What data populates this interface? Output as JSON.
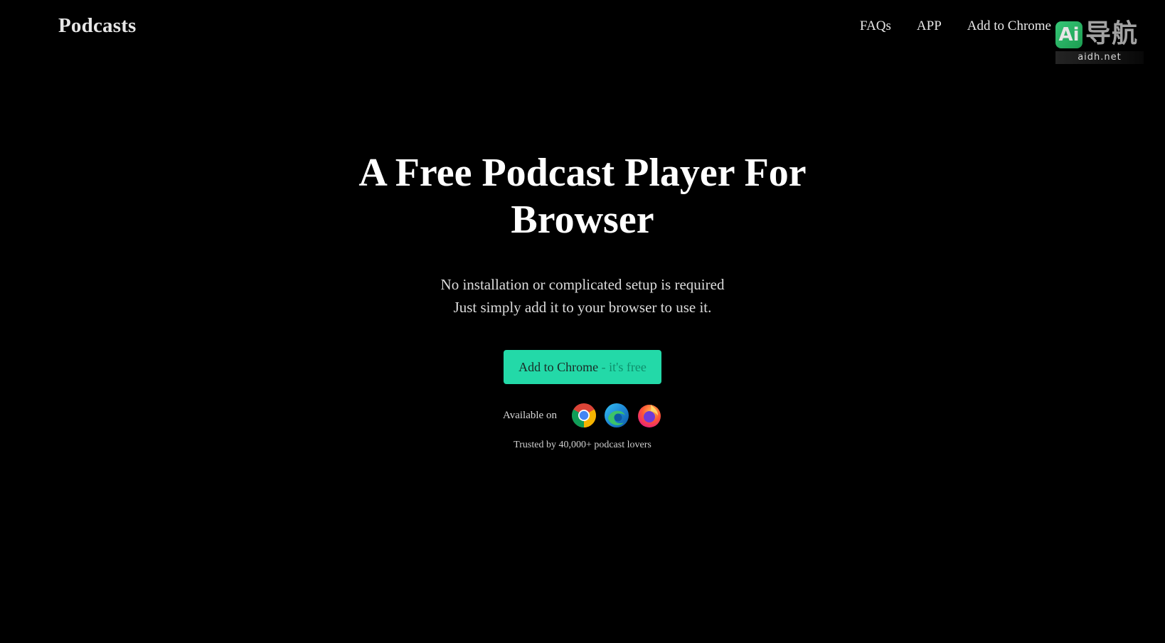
{
  "header": {
    "logo": "Podcasts",
    "nav": [
      {
        "label": "FAQs"
      },
      {
        "label": "APP"
      },
      {
        "label": "Add to Chrome"
      }
    ]
  },
  "watermark": {
    "badge": "Ai",
    "text": "导航",
    "sub": "aidh.net"
  },
  "hero": {
    "title_line1": "A Free Podcast Player For",
    "title_line2": "Browser",
    "sub_line1": "No installation or complicated setup is required",
    "sub_line2": "Just simply add it to your browser to use it.",
    "cta_main": "Add to Chrome",
    "cta_suffix": " - it's free",
    "available_label": "Available on",
    "browsers": [
      "chrome-icon",
      "edge-icon",
      "firefox-icon"
    ],
    "trusted": "Trusted by 40,000+ podcast lovers"
  },
  "colors": {
    "background": "#000000",
    "accent": "#23d9a8",
    "text": "#ffffff"
  }
}
